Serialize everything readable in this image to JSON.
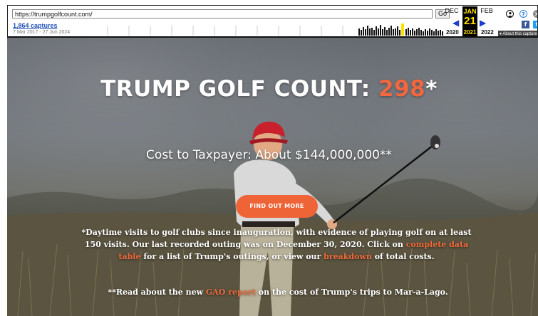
{
  "wayback": {
    "url": "https://trumpgolfcount.com/",
    "go_label": "Go",
    "captures_link": "1,864 captures",
    "date_range": "7 Mar 2017 - 27 Jun 2024",
    "prev_month": "DEC",
    "current_month": "JAN",
    "next_month": "FEB",
    "current_day": "21",
    "prev_year": "2020",
    "current_year": "2021",
    "next_year": "2022",
    "about_label": "About this capture"
  },
  "hero": {
    "title_prefix": "TRUMP GOLF COUNT: ",
    "count": "298",
    "title_suffix": "*",
    "cost_line": "Cost to Taxpayer: About $144,000,000**",
    "button_label": "FIND OUT MORE",
    "note_part1": "*Daytime visits to golf clubs since inauguration, with evidence of playing golf on at least 150 visits. Our last recorded outing was on December 30, 2020. Click on ",
    "note_link1": "complete data table",
    "note_part2": " for a list of Trump's outings, or view our ",
    "note_link2": "breakdown",
    "note_part3": " of total costs.",
    "note2_part1": "**Read about the new ",
    "note2_link": "GAO report",
    "note2_part2": " on the cost of Trump's trips to Mar-a-Lago."
  },
  "colors": {
    "accent": "#ee6436",
    "link": "#ef6a3c",
    "wayback_link": "#1f4fb8",
    "wayback_highlight": "#ffe000"
  },
  "icons": [
    "user-icon",
    "help-icon",
    "close-icon",
    "facebook-icon",
    "twitter-icon",
    "prev-arrow-icon",
    "next-arrow-icon"
  ]
}
